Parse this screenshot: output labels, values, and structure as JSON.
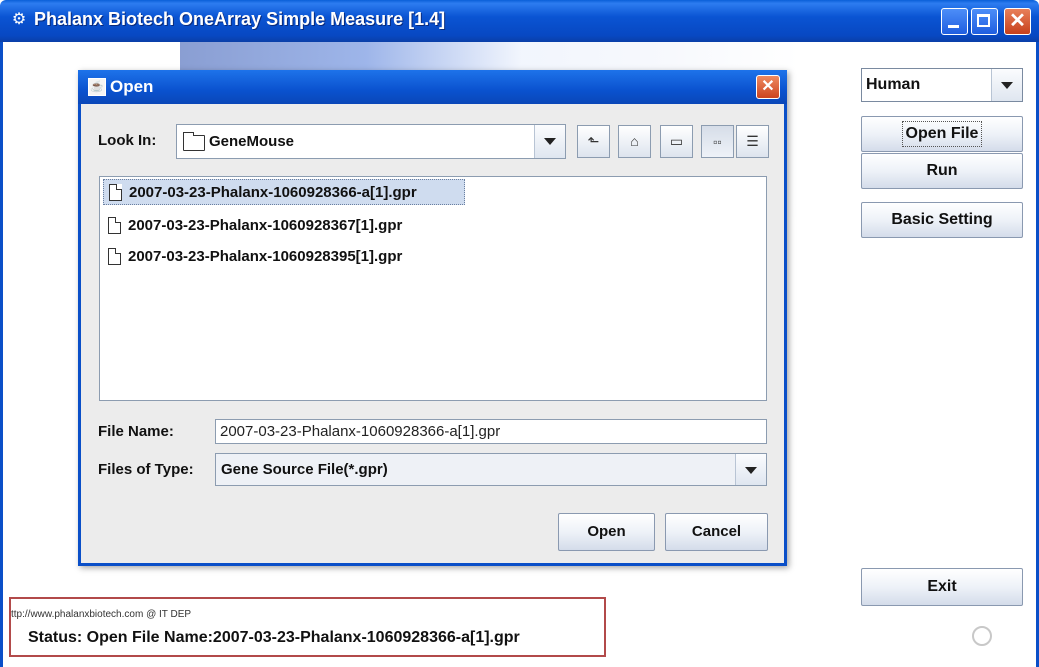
{
  "window": {
    "title": "Phalanx Biotech OneArray Simple Measure [1.4]",
    "icon": "app-logo-icon",
    "controls": [
      "minimize-icon",
      "maximize-icon",
      "close-icon"
    ]
  },
  "right_panel": {
    "species_select": "Human",
    "open_file_label": "Open File",
    "run_label": "Run",
    "basic_setting_label": "Basic Setting",
    "exit_label": "Exit"
  },
  "status": {
    "url_line": "ttp://www.phalanxbiotech.com  @  IT DEP",
    "text": "Status:  Open File Name:2007-03-23-Phalanx-1060928366-a[1].gpr"
  },
  "dialog": {
    "title": "Open",
    "look_in_label": "Look In:",
    "look_in_value": "GeneMouse",
    "toolbar_icons": [
      "up-folder-icon",
      "home-icon",
      "new-folder-icon",
      "list-view-icon",
      "details-view-icon"
    ],
    "files": [
      {
        "name": "2007-03-23-Phalanx-1060928366-a[1].gpr",
        "selected": true
      },
      {
        "name": "2007-03-23-Phalanx-1060928367[1].gpr",
        "selected": false
      },
      {
        "name": "2007-03-23-Phalanx-1060928395[1].gpr",
        "selected": false
      }
    ],
    "file_name_label": "File Name:",
    "file_name_value": "2007-03-23-Phalanx-1060928366-a[1].gpr",
    "file_type_label": "Files of Type:",
    "file_type_value": "Gene Source File(*.gpr)",
    "open_label": "Open",
    "cancel_label": "Cancel"
  }
}
